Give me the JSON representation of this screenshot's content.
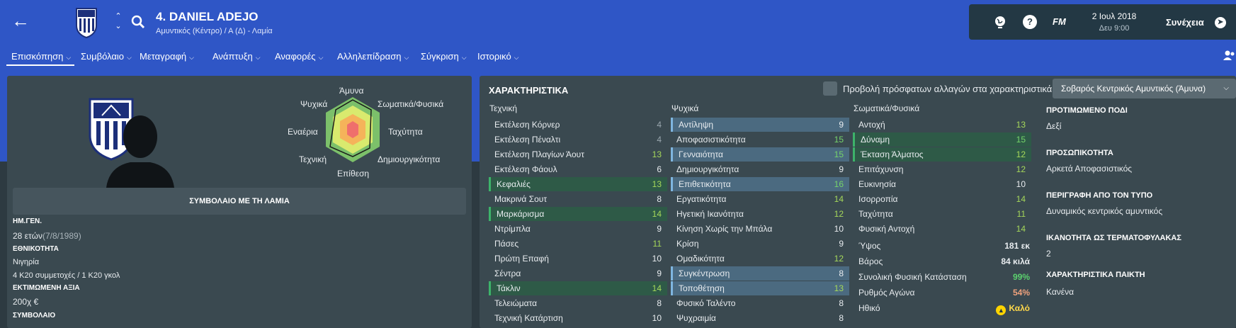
{
  "header": {
    "player_title": "4. DANIEL ADEJO",
    "player_sub": "Αμυντικός (Κέντρο) / Α (Δ) - Λαμία",
    "date": "2 Ιουλ 2018",
    "time": "Δευ 9:00",
    "fm_label": "FM",
    "continue_label": "Συνέχεια"
  },
  "tabs": [
    {
      "label": "Επισκόπηση"
    },
    {
      "label": "Συμβόλαιο"
    },
    {
      "label": "Μεταγραφή"
    },
    {
      "label": "Ανάπτυξη"
    },
    {
      "label": "Αναφορές"
    },
    {
      "label": "Αλληλεπίδραση"
    },
    {
      "label": "Σύγκριση"
    },
    {
      "label": "Ιστορικό"
    }
  ],
  "radar": {
    "top": "Άμυνα",
    "top_left": "Ψυχικά",
    "top_right": "Σωματικά/Φυσικά",
    "left": "Εναέρια",
    "right": "Ταχύτητα",
    "bottom_left": "Τεχνική",
    "bottom_right": "Δημιουργικότητα",
    "bottom": "Επίθεση"
  },
  "contract_title": "ΣΥΜΒΟΛΑΙΟ ΜΕ ΤΗ ΛΑΜΙΑ",
  "info": {
    "dob_label": "ΗΜ.ΓΕΝ.",
    "age": "28 ετών",
    "dob": "(7/8/1989)",
    "nationality_label": "ΕΘΝΙΚΟΤΗΤΑ",
    "nationality": "Νιγηρία",
    "caps": "4 Κ20 συμμετοχές / 1 Κ20 γκολ",
    "value_label": "ΕΚΤΙΜΩΜΕΝΗ ΑΞΙΑ",
    "value": "200χ €",
    "contract_label": "ΣΥΜΒΟΛΑΙΟ"
  },
  "attributes": {
    "title": "ΧΑΡΑΚΤΗΡΙΣΤΙΚΑ",
    "recent_changes_label": "Προβολή πρόσφατων αλλαγών στα χαρακτηριστικά",
    "role": "Σοβαρός Κεντρικός Αμυντικός (Άμυνα)",
    "technical_head": "Τεχνική",
    "mental_head": "Ψυχικά",
    "physical_head": "Σωματικά/Φυσικά",
    "technical": [
      {
        "name": "Εκτέλεση Κόρνερ",
        "value": "4",
        "hl": "",
        "vc": "v-grey"
      },
      {
        "name": "Εκτέλεση Πέναλτι",
        "value": "4",
        "hl": "",
        "vc": "v-grey"
      },
      {
        "name": "Εκτέλεση Πλαγίων Άουτ",
        "value": "13",
        "hl": "",
        "vc": "v-lgreen"
      },
      {
        "name": "Εκτέλεση Φάουλ",
        "value": "6",
        "hl": "",
        "vc": "v-white"
      },
      {
        "name": "Κεφαλιές",
        "value": "13",
        "hl": "hl-green",
        "vc": "v-lgreen"
      },
      {
        "name": "Μακρινά Σουτ",
        "value": "8",
        "hl": "",
        "vc": "v-white"
      },
      {
        "name": "Μαρκάρισμα",
        "value": "14",
        "hl": "hl-green",
        "vc": "v-lgreen"
      },
      {
        "name": "Ντρίμπλα",
        "value": "9",
        "hl": "",
        "vc": "v-white"
      },
      {
        "name": "Πάσες",
        "value": "11",
        "hl": "",
        "vc": "v-lgreen"
      },
      {
        "name": "Πρώτη Επαφή",
        "value": "10",
        "hl": "",
        "vc": "v-white"
      },
      {
        "name": "Σέντρα",
        "value": "9",
        "hl": "",
        "vc": "v-white"
      },
      {
        "name": "Τάκλιν",
        "value": "14",
        "hl": "hl-green",
        "vc": "v-lgreen"
      },
      {
        "name": "Τελειώματα",
        "value": "8",
        "hl": "",
        "vc": "v-white"
      },
      {
        "name": "Τεχνική Κατάρτιση",
        "value": "10",
        "hl": "",
        "vc": "v-white"
      }
    ],
    "mental": [
      {
        "name": "Αντίληψη",
        "value": "9",
        "hl": "hl-blue",
        "vc": "v-white"
      },
      {
        "name": "Αποφασιστικότητα",
        "value": "15",
        "hl": "",
        "vc": "v-green"
      },
      {
        "name": "Γενναιότητα",
        "value": "15",
        "hl": "hl-blue",
        "vc": "v-green"
      },
      {
        "name": "Δημιουργικότητα",
        "value": "9",
        "hl": "",
        "vc": "v-white"
      },
      {
        "name": "Επιθετικότητα",
        "value": "16",
        "hl": "hl-blue",
        "vc": "v-green"
      },
      {
        "name": "Εργατικότητα",
        "value": "14",
        "hl": "",
        "vc": "v-lgreen"
      },
      {
        "name": "Ηγετική Ικανότητα",
        "value": "12",
        "hl": "",
        "vc": "v-lgreen"
      },
      {
        "name": "Κίνηση Χωρίς την Μπάλα",
        "value": "10",
        "hl": "",
        "vc": "v-white"
      },
      {
        "name": "Κρίση",
        "value": "9",
        "hl": "",
        "vc": "v-white"
      },
      {
        "name": "Ομαδικότητα",
        "value": "12",
        "hl": "",
        "vc": "v-lgreen"
      },
      {
        "name": "Συγκέντρωση",
        "value": "8",
        "hl": "hl-blue",
        "vc": "v-white"
      },
      {
        "name": "Τοποθέτηση",
        "value": "13",
        "hl": "hl-blue",
        "vc": "v-lgreen"
      },
      {
        "name": "Φυσικό Ταλέντο",
        "value": "8",
        "hl": "",
        "vc": "v-white"
      },
      {
        "name": "Ψυχραιμία",
        "value": "8",
        "hl": "",
        "vc": "v-white"
      }
    ],
    "physical": [
      {
        "name": "Αντοχή",
        "value": "13",
        "hl": "",
        "vc": "v-lgreen"
      },
      {
        "name": "Δύναμη",
        "value": "15",
        "hl": "hl-green",
        "vc": "v-green"
      },
      {
        "name": "Έκταση Άλματος",
        "value": "12",
        "hl": "hl-green",
        "vc": "v-lgreen"
      },
      {
        "name": "Επιτάχυνση",
        "value": "12",
        "hl": "",
        "vc": "v-lgreen"
      },
      {
        "name": "Ευκινησία",
        "value": "10",
        "hl": "",
        "vc": "v-white"
      },
      {
        "name": "Ισορροπία",
        "value": "14",
        "hl": "",
        "vc": "v-lgreen"
      },
      {
        "name": "Ταχύτητα",
        "value": "11",
        "hl": "",
        "vc": "v-lgreen"
      },
      {
        "name": "Φυσική Αντοχή",
        "value": "14",
        "hl": "",
        "vc": "v-lgreen"
      }
    ],
    "physical_details": [
      {
        "name": "Ύψος",
        "value": "181 εκ",
        "vc": ""
      },
      {
        "name": "Βάρος",
        "value": "84 κιλά",
        "vc": ""
      },
      {
        "name": "Συνολική Φυσική Κατάσταση",
        "value": "99%",
        "vc": "pct-good"
      },
      {
        "name": "Ρυθμός Αγώνα",
        "value": "54%",
        "vc": "pct-warn"
      },
      {
        "name": "Ηθικό",
        "value": "Καλό",
        "vc": "morale"
      }
    ]
  },
  "right_info": {
    "foot_label": "ΠΡΟΤΙΜΩΜΕΝΟ ΠΟΔΙ",
    "foot": "Δεξί",
    "personality_label": "ΠΡΟΣΩΠΙΚΟΤΗΤΑ",
    "personality": "Αρκετά Αποφασιστικός",
    "media_label": "ΠΕΡΙΓΡΑΦΗ ΑΠΟ ΤΟΝ ΤΥΠΟ",
    "media": "Δυναμικός κεντρικός αμυντικός",
    "gk_label": "ΙΚΑΝΟΤΗΤΑ ΩΣ ΤΕΡΜΑΤΟΦΥΛΑΚΑΣ",
    "gk": "2",
    "traits_label": "ΧΑΡΑΚΤΗΡΙΣΤΙΚΑ ΠΑΙΚΤΗ",
    "traits": "Κανένα"
  }
}
